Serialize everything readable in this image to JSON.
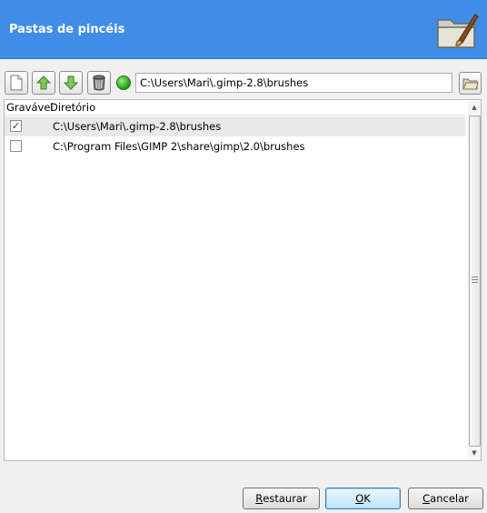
{
  "header": {
    "title": "Pastas de pincéis",
    "icon": "folder-brush-icon"
  },
  "toolbar": {
    "buttons": [
      {
        "name": "new-folder-button",
        "icon": "new-document-icon"
      },
      {
        "name": "move-up-button",
        "icon": "arrow-up-icon"
      },
      {
        "name": "move-down-button",
        "icon": "arrow-down-icon"
      },
      {
        "name": "delete-button",
        "icon": "trash-icon"
      }
    ],
    "status_icon": "green-status-icon",
    "path_value": "C:\\Users\\Mari\\.gimp-2.8\\brushes",
    "browse_icon": "folder-open-icon"
  },
  "list": {
    "columns": {
      "writable": "Gravável",
      "directory": "Diretório"
    },
    "rows": [
      {
        "checked": true,
        "path": "C:\\Users\\Mari\\.gimp-2.8\\brushes",
        "selected": true
      },
      {
        "checked": false,
        "path": "C:\\Program Files\\GIMP 2\\share\\gimp\\2.0\\brushes",
        "selected": false
      }
    ]
  },
  "buttons": {
    "restore": {
      "first": "R",
      "rest": "estaurar"
    },
    "ok": {
      "first": "O",
      "rest": "K"
    },
    "cancel": {
      "first": "C",
      "rest": "ancelar"
    }
  },
  "colors": {
    "header_bg": "#3f8de6",
    "status_green": "#2fa81c"
  }
}
